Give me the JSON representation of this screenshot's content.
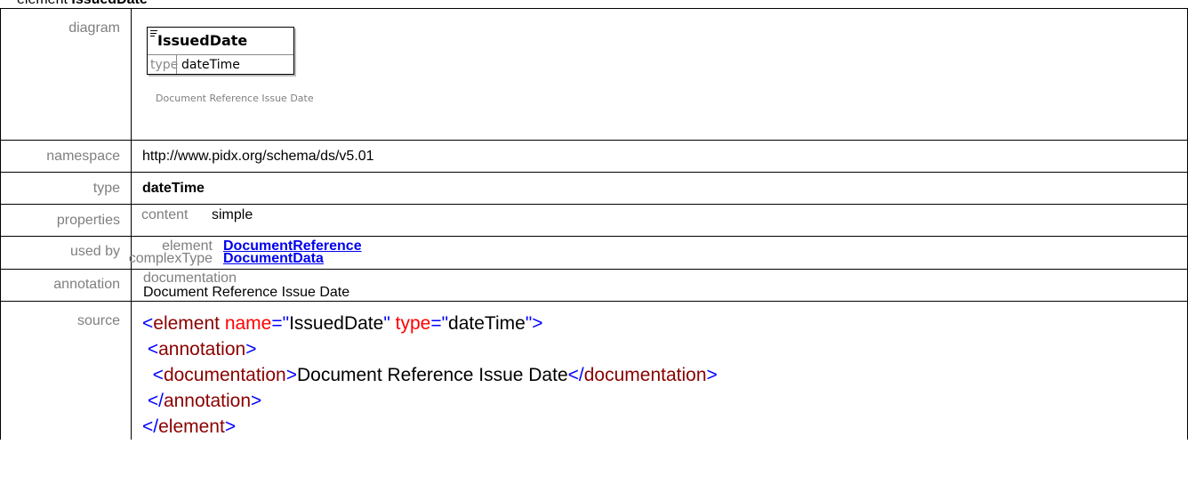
{
  "heading": {
    "prefix": "element",
    "name": "IssuedDate"
  },
  "labels": {
    "diagram": "diagram",
    "namespace": "namespace",
    "type": "type",
    "properties": "properties",
    "used_by": "used by",
    "annotation": "annotation",
    "source": "source"
  },
  "diagram": {
    "element_name": "IssuedDate",
    "type_key": "type",
    "type_value": "dateTime",
    "caption": "Document Reference Issue Date"
  },
  "namespace": "http://www.pidx.org/schema/ds/v5.01",
  "type": "dateTime",
  "properties": {
    "key": "content",
    "value": "simple"
  },
  "used_by": [
    {
      "kind": "element",
      "name": "DocumentReference"
    },
    {
      "kind": "complexType",
      "name": "DocumentData"
    }
  ],
  "annotation": {
    "key": "documentation",
    "value": "Document Reference Issue Date"
  },
  "source": {
    "line1": {
      "open": "<",
      "tag": "element",
      "attr1": "name",
      "eq1": "=\"",
      "val1": "IssuedDate",
      "close1": "\"",
      "attr2": "type",
      "eq2": "=\"",
      "val2": "dateTime",
      "end": "\">"
    },
    "line2": {
      "open": "<",
      "tag": "annotation",
      "end": ">"
    },
    "line3": {
      "open": "<",
      "tag": "documentation",
      "end": ">",
      "text": "Document Reference Issue Date",
      "close_open": "</",
      "close_tag": "documentation",
      "close_end": ">"
    },
    "line4": {
      "open": "</",
      "tag": "annotation",
      "end": ">"
    },
    "line5": {
      "open": "</",
      "tag": "element",
      "end": ">"
    }
  }
}
